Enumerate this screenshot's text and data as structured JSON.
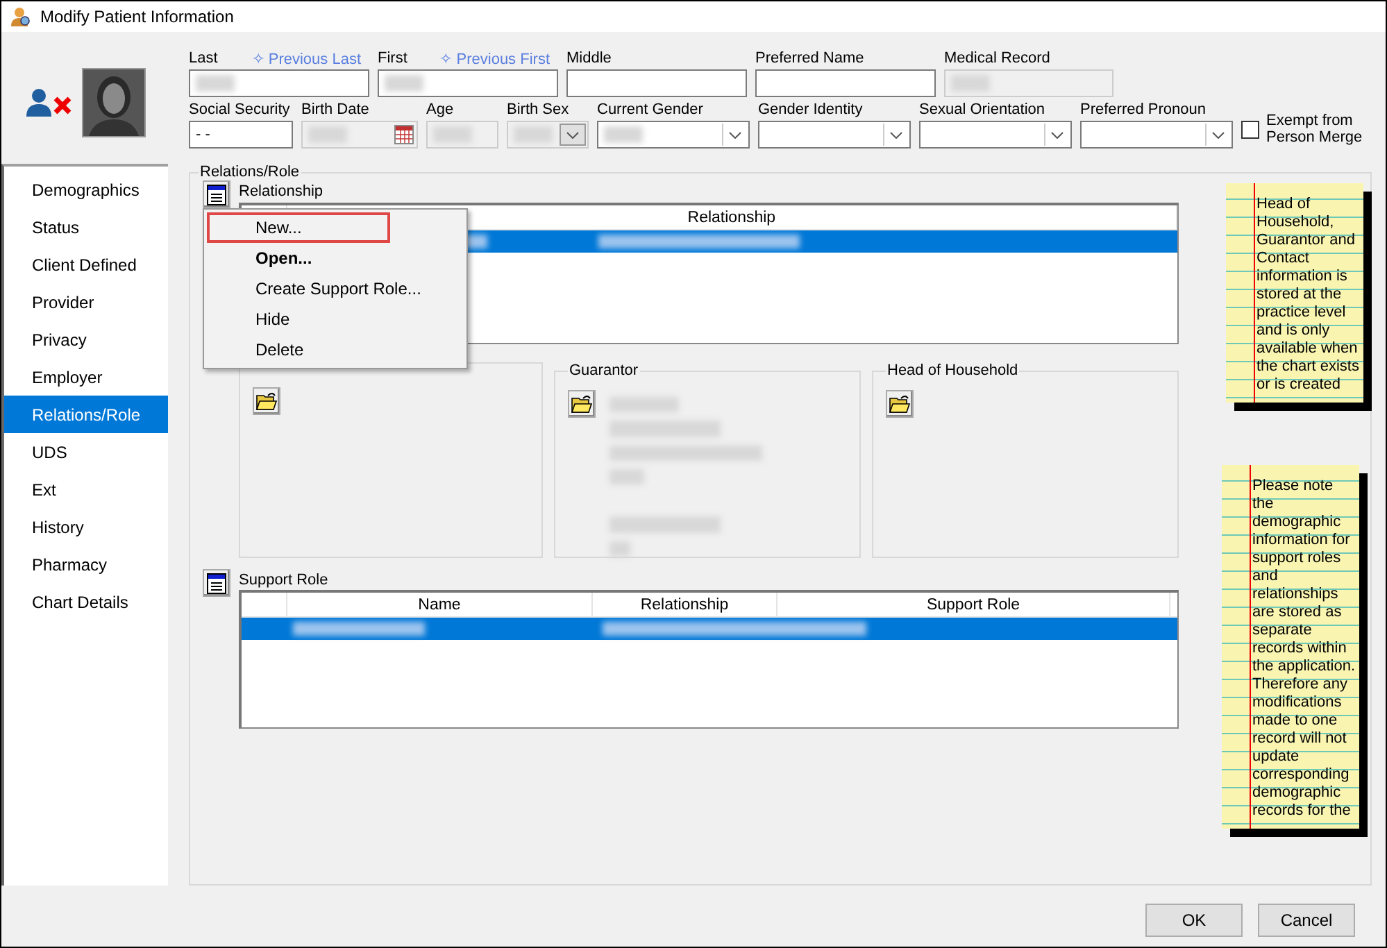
{
  "window": {
    "title": "Modify Patient Information"
  },
  "header": {
    "row_1": [
      {
        "label": "Last",
        "kind": "text",
        "link": "✧ Previous Last",
        "redacted": true,
        "disabled": false
      },
      {
        "label": "First",
        "kind": "text",
        "link": "✧ Previous First",
        "redacted": true,
        "disabled": false
      },
      {
        "label": "Middle",
        "kind": "text",
        "redacted": false,
        "disabled": false
      },
      {
        "label": "Preferred Name",
        "kind": "text",
        "redacted": false,
        "disabled": false
      },
      {
        "label": "Medical Record",
        "kind": "text",
        "redacted": true,
        "disabled": true
      }
    ],
    "row_2": [
      {
        "label": "Social Security",
        "kind": "text",
        "value": "- -",
        "redacted": false,
        "disabled": false
      },
      {
        "label": "Birth Date",
        "kind": "date",
        "redacted": true,
        "disabled": true
      },
      {
        "label": "Age",
        "kind": "text",
        "redacted": true,
        "disabled": true
      },
      {
        "label": "Birth Sex",
        "kind": "combo",
        "redacted": true,
        "disabled": true
      },
      {
        "label": "Current Gender",
        "kind": "combo",
        "redacted": true,
        "disabled": false
      },
      {
        "label": "Gender Identity",
        "kind": "combo",
        "redacted": false,
        "disabled": false
      },
      {
        "label": "Sexual Orientation",
        "kind": "combo",
        "redacted": false,
        "disabled": false
      },
      {
        "label": "Preferred Pronoun",
        "kind": "combo",
        "redacted": false,
        "disabled": false
      },
      {
        "label": "Exempt from Person Merge",
        "kind": "checkbox",
        "checked": false
      }
    ]
  },
  "sidebar": {
    "items": [
      {
        "label": "Demographics",
        "selected": false
      },
      {
        "label": "Status",
        "selected": false
      },
      {
        "label": "Client Defined",
        "selected": false
      },
      {
        "label": "Provider",
        "selected": false
      },
      {
        "label": "Privacy",
        "selected": false
      },
      {
        "label": "Employer",
        "selected": false
      },
      {
        "label": "Relations/Role",
        "selected": true
      },
      {
        "label": "UDS",
        "selected": false
      },
      {
        "label": "Ext",
        "selected": false
      },
      {
        "label": "History",
        "selected": false
      },
      {
        "label": "Pharmacy",
        "selected": false
      },
      {
        "label": "Chart Details",
        "selected": false
      }
    ]
  },
  "group": {
    "title": "Relations/Role",
    "relationship": {
      "label": "Relationship",
      "columns": [
        "Relationship"
      ],
      "rows": [
        {
          "selected": true
        }
      ]
    },
    "context_menu": [
      {
        "label": "New...",
        "bold": false,
        "highlighted": true
      },
      {
        "label": "Open...",
        "bold": true,
        "highlighted": false
      },
      {
        "label": "Create Support Role...",
        "bold": false,
        "highlighted": false
      },
      {
        "label": "Hide",
        "bold": false,
        "highlighted": false
      },
      {
        "label": "Delete",
        "bold": false,
        "highlighted": false
      }
    ],
    "panels": [
      {
        "redacted": false
      },
      {
        "title": "Guarantor",
        "redacted": true
      },
      {
        "title": "Head of Household",
        "redacted": false
      }
    ],
    "support_role": {
      "label": "Support Role",
      "columns": [
        "Name",
        "Relationship",
        "Support Role"
      ],
      "rows": [
        {
          "selected": true
        }
      ]
    },
    "notes": [
      "Head of Household, Guarantor and Contact information is stored at the practice level and is only available when the chart exists or is created",
      "Please note the demographic information for support roles and relationships are stored as separate records within the application.  Therefore any modifications made to one record will not update corresponding demographic records for the"
    ]
  },
  "buttons": [
    "OK",
    "Cancel"
  ]
}
